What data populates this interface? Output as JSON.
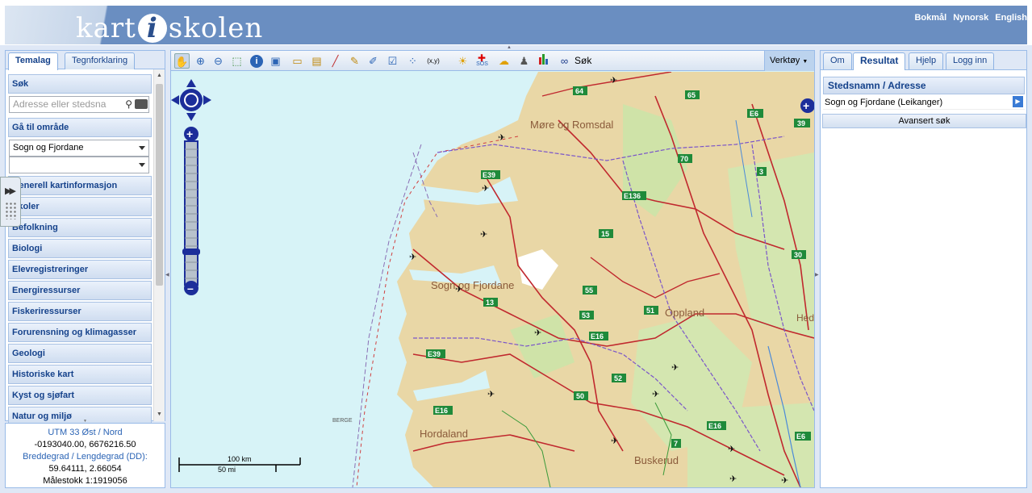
{
  "header": {
    "logo_left": "kart",
    "logo_i": "i",
    "logo_right": "skolen",
    "languages": [
      "Bokmål",
      "Nynorsk",
      "English"
    ]
  },
  "left_panel": {
    "tabs": [
      "Temalag",
      "Tegnforklaring"
    ],
    "active_tab": "Temalag",
    "search_title": "Søk",
    "search_placeholder": "Adresse eller stedsna",
    "goto_title": "Gå til område",
    "goto_value": "Sogn og Fjordane",
    "goto_value2": "",
    "sections": [
      "Generell kartinformasjon",
      "Skoler",
      "Befolkning",
      "Biologi",
      "Elevregistreringer",
      "Energiressurser",
      "Fiskeriressurser",
      "Forurensning og klimagasser",
      "Geologi",
      "Historiske kart",
      "Kyst og sjøfart",
      "Natur og miljø"
    ]
  },
  "coords": {
    "utm_label": "UTM 33 Øst / Nord",
    "utm_value": "-0193040.00, 6676216.50",
    "latlon_label": "Breddegrad / Lengdegrad (DD):",
    "latlon_value": "59.64111, 2.66054",
    "scale": "Målestokk 1:1919056"
  },
  "toolbar": {
    "search_label": "Søk",
    "xy_label": "(x,y)",
    "sos_label": "SOS",
    "tools_label": "Verktøy"
  },
  "map": {
    "regions": [
      "Møre og Romsdal",
      "Sogn og Fjordane",
      "Oppland",
      "Hordaland",
      "Buskerud",
      "Hed"
    ],
    "cities": [
      "BERGE"
    ],
    "roads": [
      "64",
      "65",
      "E39",
      "E6",
      "E136",
      "70",
      "3",
      "15",
      "30",
      "55",
      "13",
      "53",
      "51",
      "E16",
      "E39",
      "52",
      "50",
      "E16",
      "E16",
      "7",
      "E6",
      "39"
    ],
    "scale_km": "100 km",
    "scale_mi": "50 mi"
  },
  "right_panel": {
    "tabs": [
      "Om",
      "Resultat",
      "Hjelp",
      "Logg inn"
    ],
    "active_tab": "Resultat",
    "result_title": "Stedsnamn / Adresse",
    "result_item": "Sogn og Fjordane (Leikanger)",
    "advanced_search": "Avansert søk"
  },
  "colors": {
    "banner": "#6a8ec1",
    "panel_border": "#99bbe8",
    "sea": "#d7f3f7",
    "land": "#e7d6a6",
    "road": "#c0282e"
  }
}
